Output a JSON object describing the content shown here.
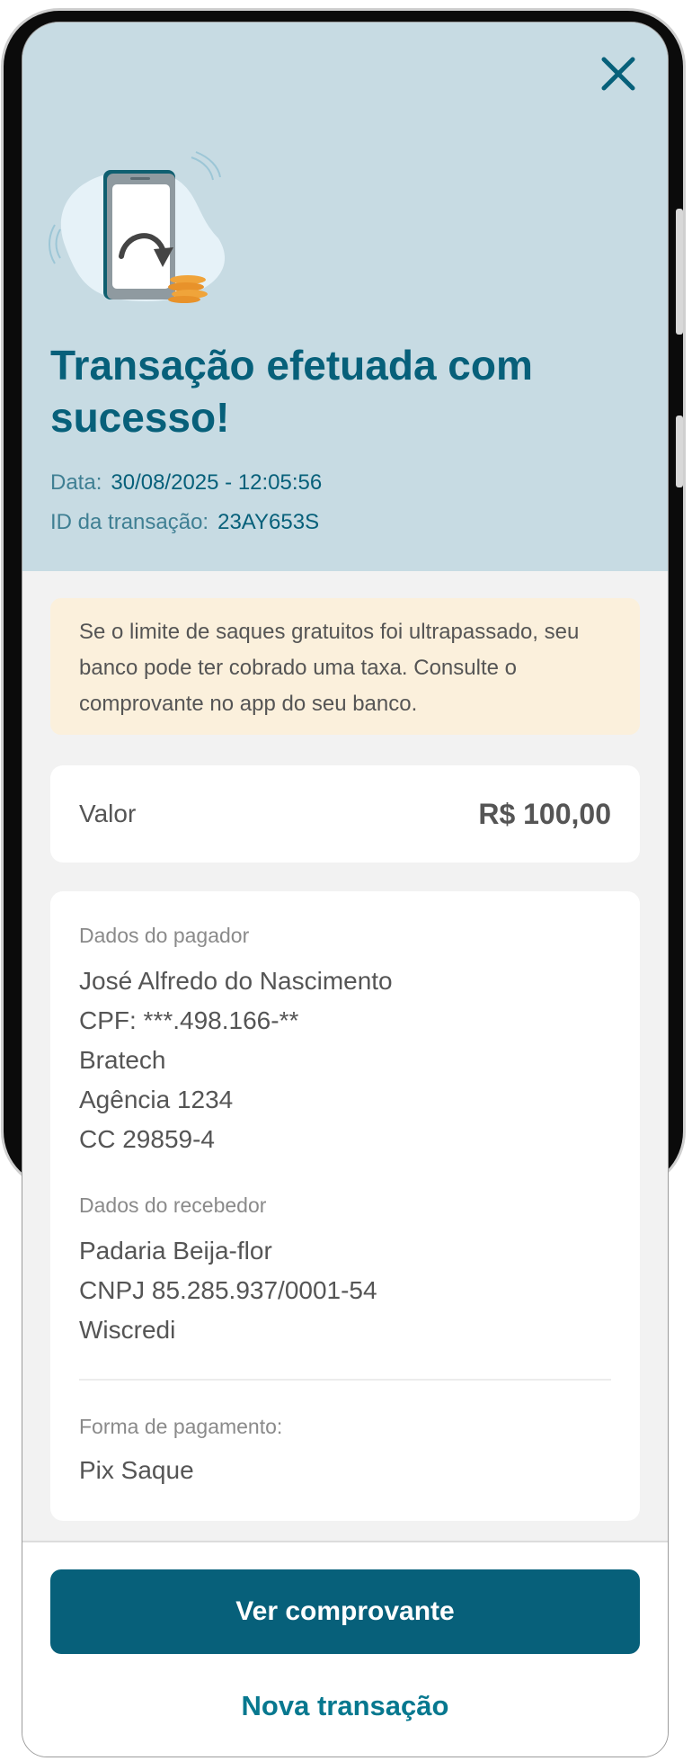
{
  "header": {
    "close_icon": "close-icon",
    "illustration": "phone-with-coins-illustration",
    "title": "Transação efetuada com sucesso!",
    "date_label": "Data:",
    "date_value": "30/08/2025 - 12:05:56",
    "id_label": "ID da transação:",
    "id_value": "23AY653S"
  },
  "warning": {
    "text": "Se o limite de saques gratuitos foi ultrapassado, seu banco pode ter cobrado uma taxa. Consulte o comprovante no app do seu banco."
  },
  "amount": {
    "label": "Valor",
    "value": "R$ 100,00"
  },
  "payer": {
    "title": "Dados do pagador",
    "lines": [
      "José Alfredo do Nascimento",
      "CPF: ***.498.166-**",
      "Bratech",
      "Agência 1234",
      "CC 29859-4"
    ]
  },
  "receiver": {
    "title": "Dados do recebedor",
    "lines": [
      "Padaria Beija-flor",
      "CNPJ 85.285.937/0001-54",
      "Wiscredi"
    ]
  },
  "payment": {
    "label": "Forma de pagamento:",
    "value": "Pix Saque"
  },
  "actions": {
    "primary_label": "Ver comprovante",
    "secondary_label": "Nova transação"
  },
  "colors": {
    "brand": "#07607a",
    "hero_bg": "#c7dbe3",
    "warning_bg": "#fbf0dc"
  }
}
